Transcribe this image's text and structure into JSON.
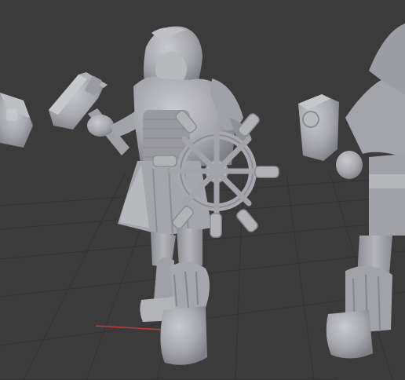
{
  "viewport": {
    "background": "#3b3b3b",
    "grid_color": "#2f2f2f",
    "x_axis_color": "#c83a3a",
    "model_color": "#a9aaaf",
    "model_shadow": "#7d7e83",
    "model_highlight": "#c6c7cb"
  },
  "models": [
    {
      "label": "left-partial-hammer"
    },
    {
      "label": "center-dwarf-with-ship-wheel"
    },
    {
      "label": "right-partial-figure"
    }
  ]
}
